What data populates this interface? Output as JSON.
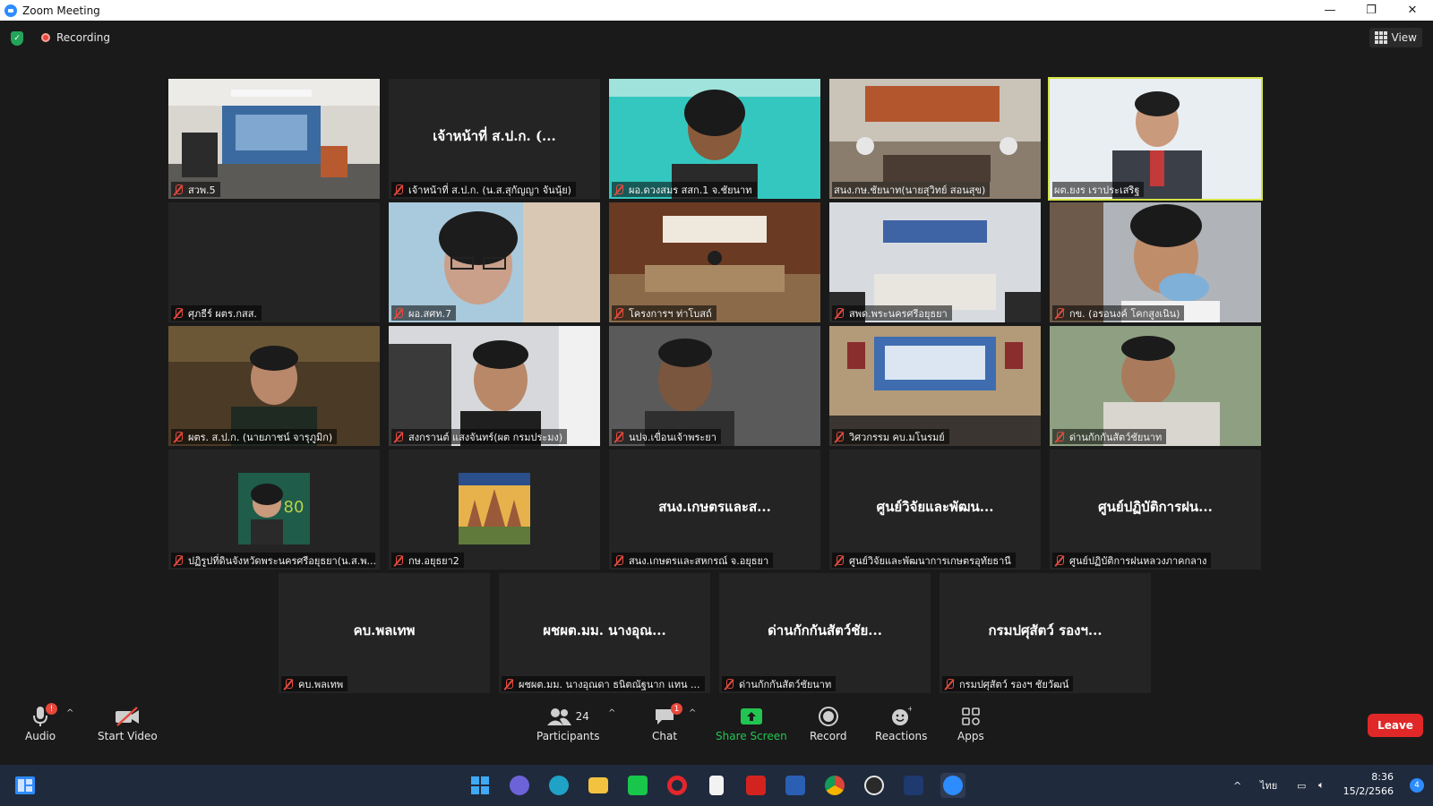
{
  "window": {
    "title": "Zoom Meeting",
    "controls": [
      "—",
      "❐",
      "✕"
    ]
  },
  "topbar": {
    "recording_label": "Recording",
    "view_label": "View"
  },
  "tiles": [
    {
      "label": "สวพ.5",
      "center": ""
    },
    {
      "label": "เจ้าหน้าที่ ส.ป.ก. (น.ส.สุกัญญา จันนุ้ย)",
      "center": "เจ้าหน้าที่ ส.ป.ก. (..."
    },
    {
      "label": "ผอ.ดวงสมร สสก.1 จ.ชัยนาท",
      "center": ""
    },
    {
      "label": "สนง.กษ.ชัยนาท(นายสุวิทย์ สอนสุข)",
      "center": ""
    },
    {
      "label": "ผต.ยงร เราประเสริฐ",
      "center": ""
    },
    {
      "label": "ศุภธีร์ ผตร.กสส.",
      "center": ""
    },
    {
      "label": "ผอ.สศท.7",
      "center": ""
    },
    {
      "label": "โครงการฯ ท่าโบสถ์",
      "center": ""
    },
    {
      "label": "สพด.พระนครศรีอยุธยา",
      "center": ""
    },
    {
      "label": "กข. (อรอนงค์ โคกสูงเนิน)",
      "center": ""
    },
    {
      "label": "ผตร. ส.ป.ก. (นายภาชน์ จารุภูมิก)",
      "center": ""
    },
    {
      "label": "สงกรานต์ แสงจันทร์(ผต กรมประมง)",
      "center": ""
    },
    {
      "label": "นปจ.เขื่อนเจ้าพระยา",
      "center": ""
    },
    {
      "label": "วิศวกรรม คบ.มโนรมย์",
      "center": ""
    },
    {
      "label": "ด่านกักกันสัตว์ชัยนาท",
      "center": ""
    },
    {
      "label": "ปฏิรูปที่ดินจังหวัดพระนครศรีอยุธยา(น.ส.พ...",
      "center": ""
    },
    {
      "label": "กษ.อยุธยา2",
      "center": ""
    },
    {
      "label": "สนง.เกษตรและสหกรณ์ จ.อยุธยา",
      "center": "สนง.เกษตรและส..."
    },
    {
      "label": "ศูนย์วิจัยและพัฒนาการเกษตรอุทัยธานี",
      "center": "ศูนย์วิจัยและพัฒน..."
    },
    {
      "label": "ศูนย์ปฏิบัติการฝนหลวงภาคกลาง",
      "center": "ศูนย์ปฏิบัติการฝน..."
    },
    {
      "label": "คบ.พลเทพ",
      "center": "คบ.พลเทพ"
    },
    {
      "label": "ผชผต.มม. นางอุณดา ธนิตณัฐนาก แทน ...",
      "center": "ผชผต.มม. นางอุณ..."
    },
    {
      "label": "ด่านกักกันสัตว์ชัยนาท",
      "center": "ด่านกักกันสัตว์ชัย..."
    },
    {
      "label": "กรมปศุสัตว์ รองฯ ชัยวัฒน์",
      "center": "กรมปศุสัตว์ รองฯ..."
    }
  ],
  "toolbar": {
    "audio": {
      "label": "Audio",
      "badge": "!"
    },
    "video": {
      "label": "Start Video"
    },
    "participants": {
      "label": "Participants",
      "count": "24"
    },
    "chat": {
      "label": "Chat",
      "badge": "1"
    },
    "share": {
      "label": "Share Screen"
    },
    "record": {
      "label": "Record"
    },
    "reactions": {
      "label": "Reactions"
    },
    "apps": {
      "label": "Apps"
    },
    "leave": {
      "label": "Leave"
    }
  },
  "taskbar": {
    "language": "ไทย",
    "time": "8:36",
    "date": "15/2/2566",
    "notifications": "4"
  },
  "colors": {
    "accent": "#2d8cff",
    "active_speaker": "#d5e345",
    "leave": "#e02828",
    "share": "#23c552"
  }
}
